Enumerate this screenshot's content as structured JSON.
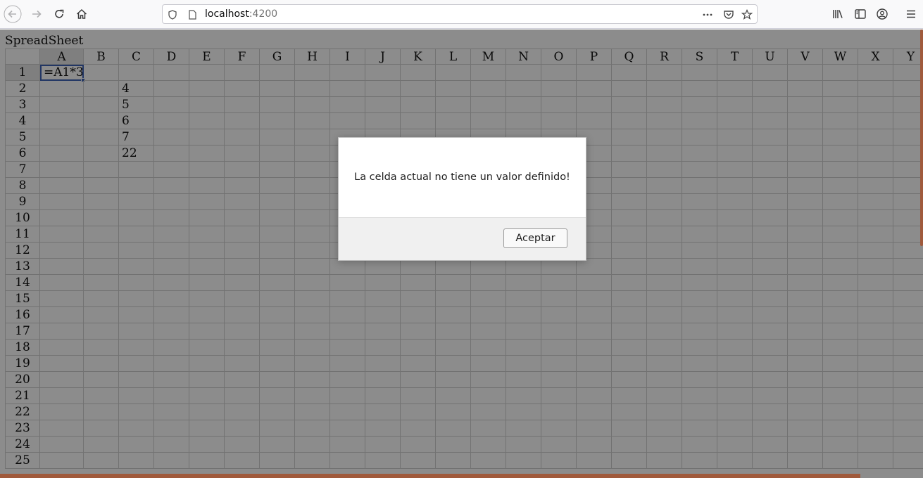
{
  "browser": {
    "url_host": "localhost",
    "url_port": ":4200",
    "icons": [
      "back-arrow-icon",
      "forward-arrow-icon",
      "reload-icon",
      "home-icon",
      "shield-icon",
      "page-icon",
      "more-dots-icon",
      "pocket-icon",
      "star-icon",
      "library-icon",
      "sidebar-icon",
      "account-icon",
      "menu-icon"
    ]
  },
  "sheet": {
    "title": "SpreadSheet",
    "columns": [
      "A",
      "B",
      "C",
      "D",
      "E",
      "F",
      "G",
      "H",
      "I",
      "J",
      "K",
      "L",
      "M",
      "N",
      "O",
      "P",
      "Q",
      "R",
      "S",
      "T",
      "U",
      "V",
      "W",
      "X",
      "Y"
    ],
    "rows": [
      "1",
      "2",
      "3",
      "4",
      "5",
      "6",
      "7",
      "8",
      "9",
      "10",
      "11",
      "12",
      "13",
      "14",
      "15",
      "16",
      "17",
      "18",
      "19",
      "20",
      "21",
      "22",
      "23",
      "24",
      "25"
    ],
    "active_cell": "A1",
    "cells": [
      {
        "ref": "A1",
        "value": "=A1*3"
      },
      {
        "ref": "C2",
        "value": "4"
      },
      {
        "ref": "C3",
        "value": "5"
      },
      {
        "ref": "C4",
        "value": "6"
      },
      {
        "ref": "C5",
        "value": "7"
      },
      {
        "ref": "C6",
        "value": "22"
      }
    ]
  },
  "dialog": {
    "message": "La celda actual no tiene un valor definido!",
    "button_label": "Aceptar"
  },
  "colors": {
    "active_cell_border": "#3e63b6",
    "scrollbar": "#a05a3c"
  }
}
